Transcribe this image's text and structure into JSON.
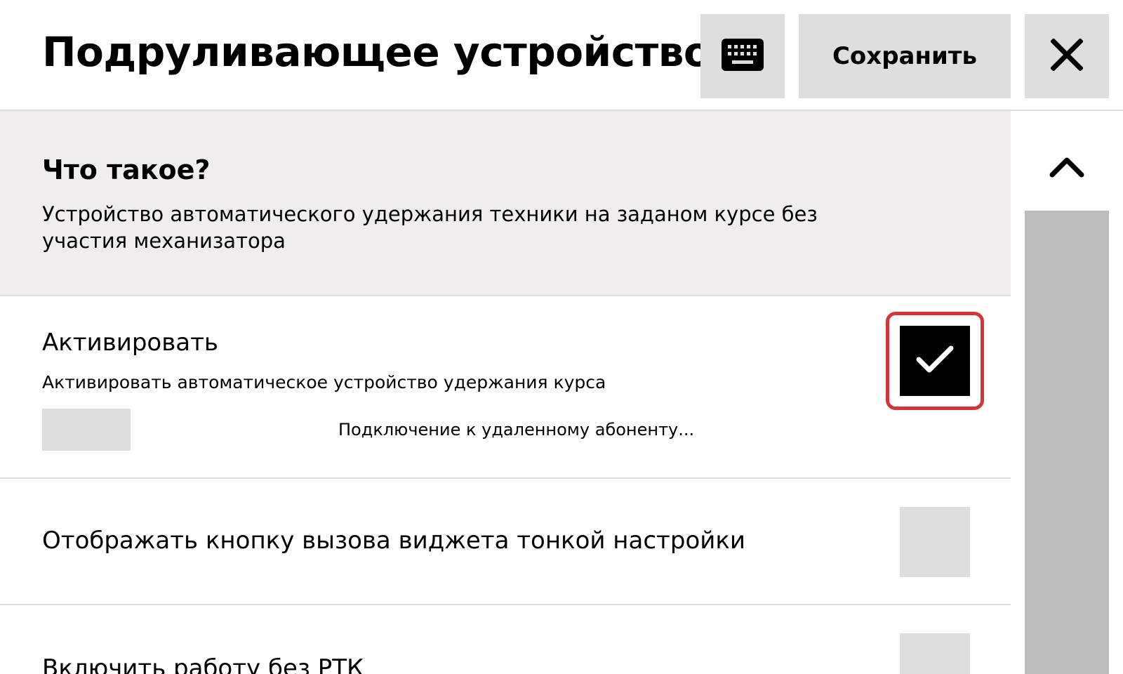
{
  "header": {
    "title": "Подруливающее устройство",
    "save_label": "Сохранить",
    "icons": {
      "keyboard": "keyboard-icon",
      "close": "close-icon"
    }
  },
  "info": {
    "heading": "Что такое?",
    "text": "Устройство автоматического удержания техники на заданом курсе без участия механизатора"
  },
  "settings": {
    "items": [
      {
        "title": "Активировать",
        "description": "Активировать автоматическое устройство удержания курса",
        "status": "Подключение к удаленному абоненту...",
        "checked": true
      },
      {
        "title": "Отображать кнопку вызова виджета тонкой настройки",
        "checked": false
      },
      {
        "title": "Включить работу без РТК",
        "checked": false
      }
    ]
  },
  "scrollbar": {
    "up_icon": "chevron-up-icon"
  },
  "colors": {
    "button_bg": "#dcdfdd",
    "info_bg": "#efeeec",
    "focus_ring": "#d3353a",
    "scroll_track": "#b9bdbb"
  }
}
